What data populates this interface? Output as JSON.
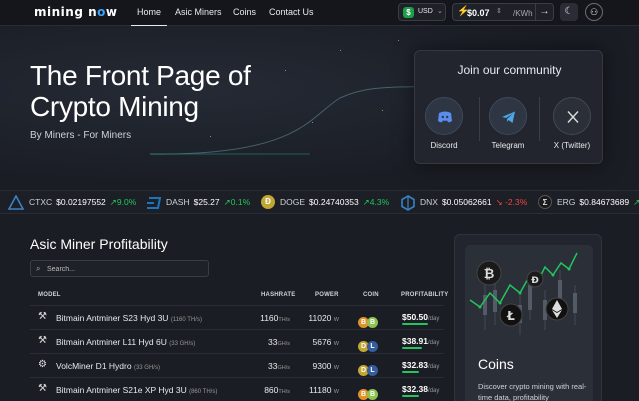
{
  "nav": {
    "logo_left": "mining n",
    "logo_o": "o",
    "logo_right": "w",
    "links": [
      "Home",
      "Asic Miners",
      "Coins",
      "Contact Us"
    ],
    "currency": "USD",
    "electricity_price": "$0.07",
    "electricity_unit": "/KWh"
  },
  "hero": {
    "title_line1": "The Front Page of",
    "title_line2": "Crypto Mining",
    "subtitle": "By Miners - For Miners"
  },
  "community": {
    "title": "Join our community",
    "items": [
      {
        "label": "Discord",
        "icon": "discord-icon"
      },
      {
        "label": "Telegram",
        "icon": "telegram-icon"
      },
      {
        "label": "X (Twitter)",
        "icon": "x-icon"
      }
    ]
  },
  "ticker": [
    {
      "symbol": "CTXC",
      "price": "$0.02197552",
      "change": "↗9.0%",
      "dir": "up",
      "color": "#3b82c4"
    },
    {
      "symbol": "DASH",
      "price": "$25.27",
      "change": "↗0.1%",
      "dir": "up",
      "color": "#1c75bc"
    },
    {
      "symbol": "DOGE",
      "price": "$0.24740353",
      "change": "↗4.3%",
      "dir": "up",
      "color": "#c2a633"
    },
    {
      "symbol": "DNX",
      "price": "$0.05062661",
      "change": "↘ -2.3%",
      "dir": "down",
      "color": "#3b82c4"
    },
    {
      "symbol": "ERG",
      "price": "$0.84673689",
      "change": "↗",
      "dir": "up",
      "color": "#333"
    }
  ],
  "profitability": {
    "title": "Asic Miner Profitability",
    "search_placeholder": "Search...",
    "headers": {
      "model": "MODEL",
      "hashrate": "HASHRATE",
      "power": "POWER",
      "coin": "COIN",
      "profitability": "PROFITABILITY"
    },
    "rows": [
      {
        "model": "Bitmain Antminer S23 Hyd 3U",
        "model_hr": "(1160 TH/s)",
        "hashrate": "1160",
        "hash_unit": "TH/s",
        "power": "11020",
        "power_unit": "W",
        "coins": [
          "B",
          "B"
        ],
        "profit": "$50.50",
        "profit_unit": "/day"
      },
      {
        "model": "Bitmain Antminer L11 Hyd 6U",
        "model_hr": "(33 GH/s)",
        "hashrate": "33",
        "hash_unit": "GH/s",
        "power": "5676",
        "power_unit": "W",
        "coins": [
          "D",
          "L"
        ],
        "profit": "$38.91",
        "profit_unit": "/day"
      },
      {
        "model": "VolcMiner D1 Hydro",
        "model_hr": "(33 GH/s)",
        "hashrate": "33",
        "hash_unit": "GH/s",
        "power": "9300",
        "power_unit": "W",
        "coins": [
          "D",
          "L"
        ],
        "profit": "$32.83",
        "profit_unit": "/day"
      },
      {
        "model": "Bitmain Antminer S21e XP Hyd 3U",
        "model_hr": "(860 TH/s)",
        "hashrate": "860",
        "hash_unit": "TH/s",
        "power": "11180",
        "power_unit": "W",
        "coins": [
          "B",
          "B"
        ],
        "profit": "$32.38",
        "profit_unit": "/day"
      }
    ]
  },
  "coins_card": {
    "title": "Coins",
    "description": "Discover crypto mining with real-time data, profitability"
  }
}
